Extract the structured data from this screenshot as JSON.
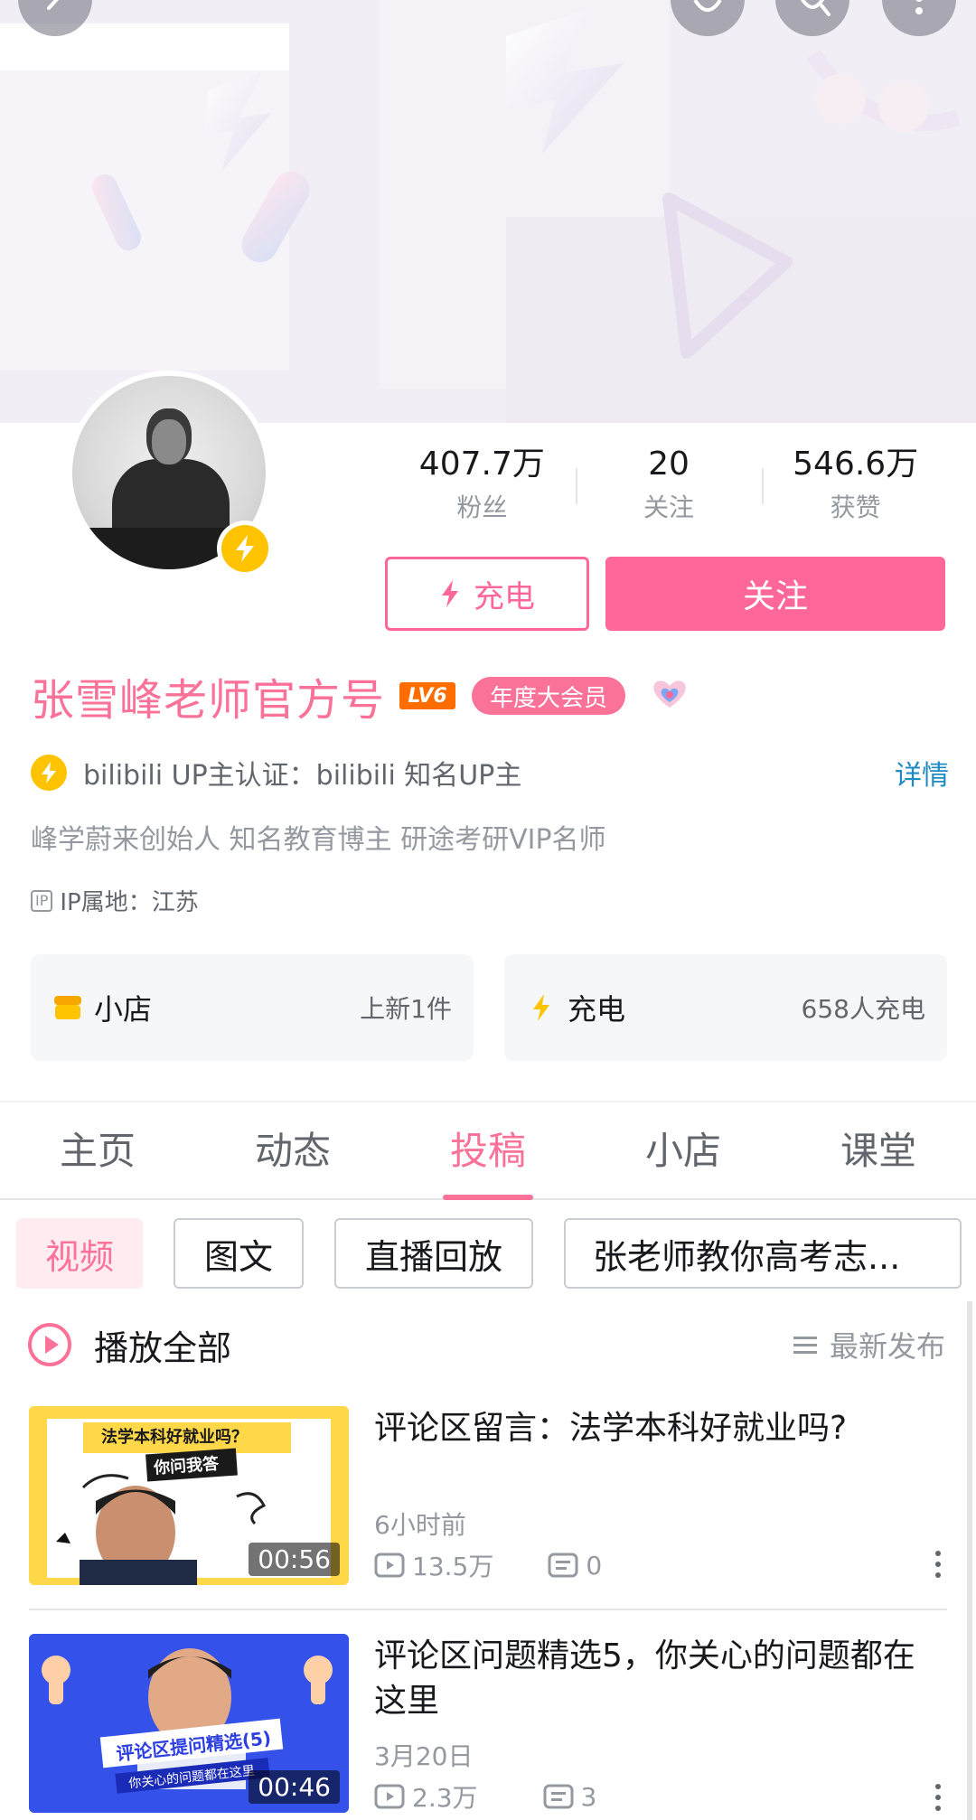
{
  "profile": {
    "name": "张雪峰老师官方号",
    "level": "LV6",
    "vip_label": "年度大会员",
    "stats": [
      {
        "value": "407.7万",
        "label": "粉丝"
      },
      {
        "value": "20",
        "label": "关注"
      },
      {
        "value": "546.6万",
        "label": "获赞"
      }
    ],
    "charge_button": "充电",
    "follow_button": "关注",
    "certification": "bilibili UP主认证：bilibili 知名UP主",
    "cert_detail": "详情",
    "bio": "峰学蔚来创始人 知名教育博主 研途考研VIP名师",
    "ip_tag": "IP",
    "ip_location": "IP属地：江苏"
  },
  "cards": [
    {
      "title": "小店",
      "meta": "上新1件",
      "icon": "shop-icon"
    },
    {
      "title": "充电",
      "meta": "658人充电",
      "icon": "lightning-icon"
    }
  ],
  "tabs": [
    "主页",
    "动态",
    "投稿",
    "小店",
    "课堂"
  ],
  "active_tab": "投稿",
  "chips": [
    "视频",
    "图文",
    "直播回放",
    "张老师教你高考志..."
  ],
  "playall": {
    "label": "播放全部",
    "sort": "最新发布"
  },
  "videos": [
    {
      "title": "评论区留言：法学本科好就业吗?",
      "date": "6小时前",
      "views": "13.5万",
      "comments": "0",
      "duration": "00:56",
      "thumb_text": "法学本科好就业吗？",
      "thumb_sub": "你问我答"
    },
    {
      "title": "评论区问题精选5，你关心的问题都在这里",
      "date": "3月20日",
      "views": "2.3万",
      "comments": "3",
      "duration": "00:46",
      "thumb_text": "评论区提问精选(5)",
      "thumb_sub": "你关心的问题都在这里"
    }
  ],
  "colors": {
    "accent": "#fb7299",
    "button": "#ff6699",
    "gold": "#ffc300",
    "link": "#1e8bc3"
  }
}
